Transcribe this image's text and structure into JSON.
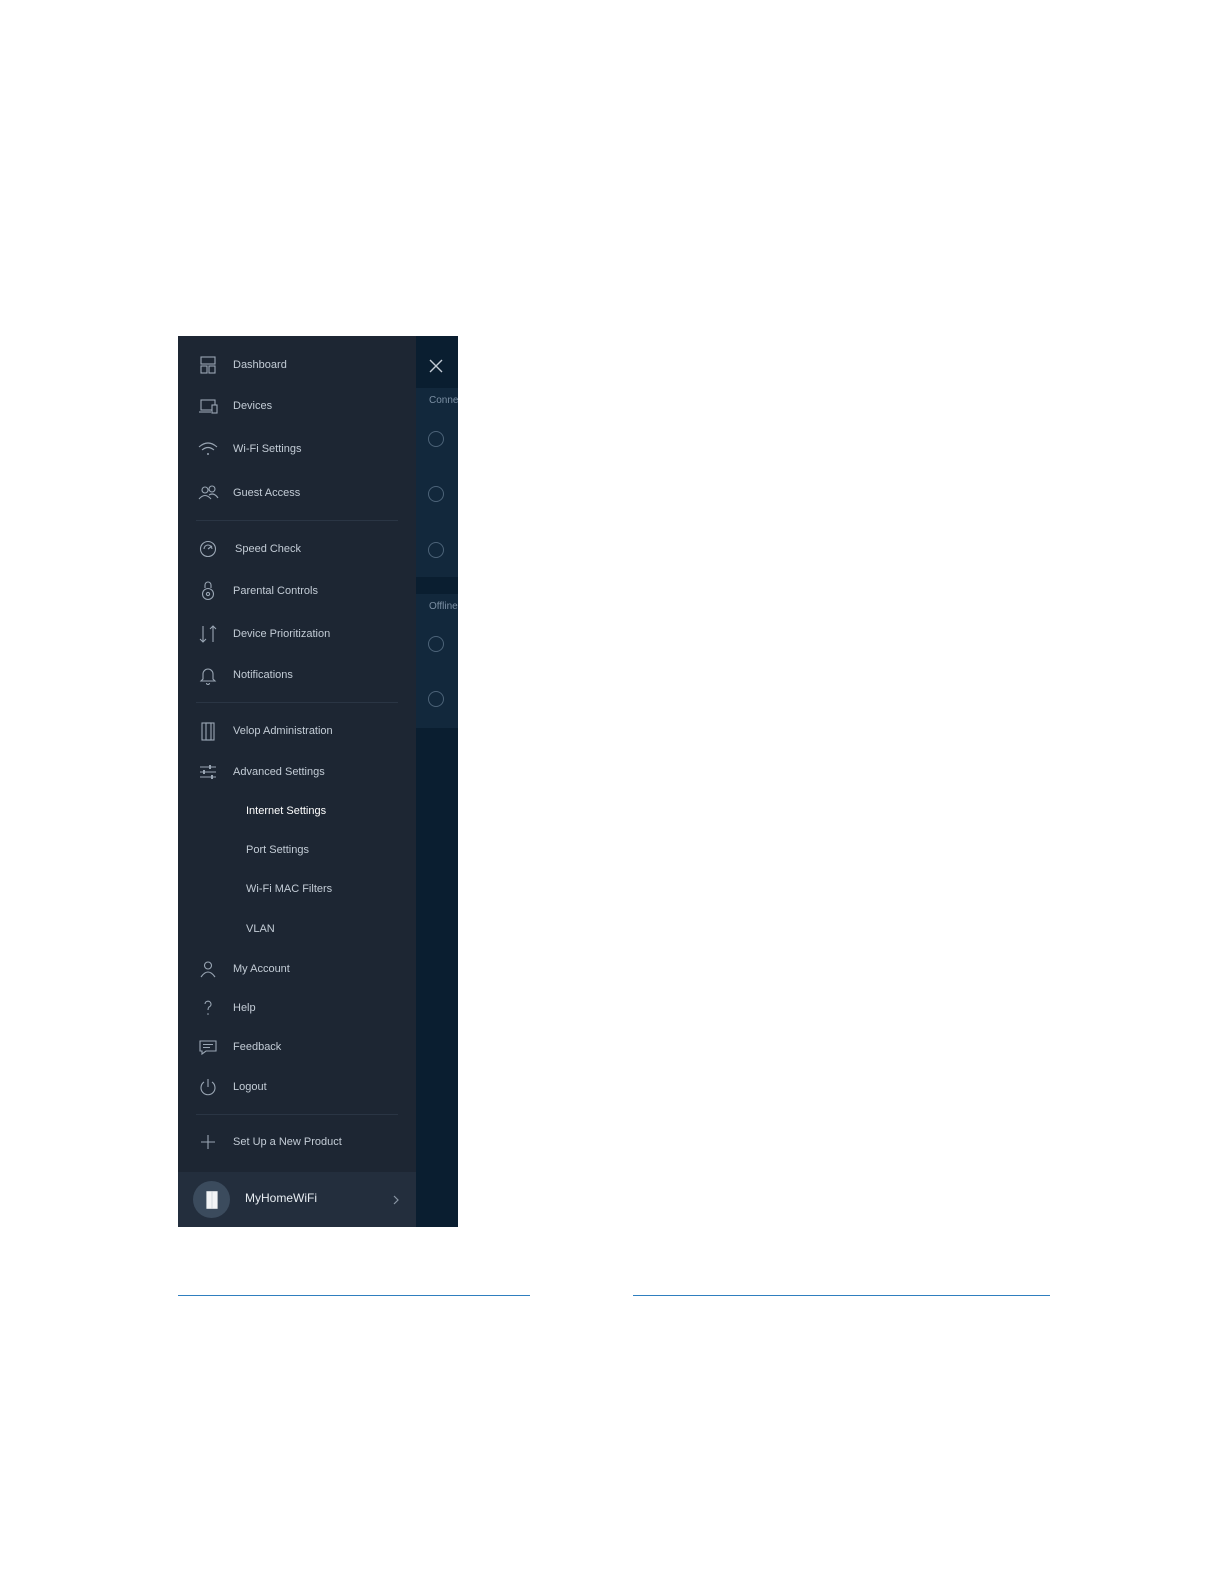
{
  "menu": {
    "items": [
      {
        "label": "Dashboard",
        "icon": "dashboard-icon"
      },
      {
        "label": "Devices",
        "icon": "devices-icon"
      },
      {
        "label": "Wi-Fi Settings",
        "icon": "wifi-icon"
      },
      {
        "label": "Guest Access",
        "icon": "guests-icon"
      },
      {
        "label": "Speed Check",
        "icon": "speedometer-icon"
      },
      {
        "label": "Parental Controls",
        "icon": "lock-icon"
      },
      {
        "label": "Device Prioritization",
        "icon": "priority-arrows-icon"
      },
      {
        "label": "Notifications",
        "icon": "bell-icon"
      },
      {
        "label": "Velop Administration",
        "icon": "velop-node-icon"
      },
      {
        "label": "Advanced Settings",
        "icon": "sliders-icon"
      }
    ],
    "advanced_sub": [
      {
        "label": "Internet Settings",
        "active": true
      },
      {
        "label": "Port Settings"
      },
      {
        "label": "Wi-Fi MAC Filters"
      },
      {
        "label": "VLAN"
      }
    ],
    "account_items": [
      {
        "label": "My Account",
        "icon": "user-icon"
      },
      {
        "label": "Help",
        "icon": "question-icon"
      },
      {
        "label": "Feedback",
        "icon": "chat-icon"
      },
      {
        "label": "Logout",
        "icon": "power-icon"
      }
    ],
    "setup": {
      "label": "Set Up a New Product",
      "icon": "plus-icon"
    },
    "network": {
      "name": "MyHomeWiFi"
    }
  },
  "behind": {
    "connected_label": "Conne",
    "offline_label": "Offline"
  },
  "colors": {
    "menu_bg": "#1d2633",
    "behind_bg": "#0a1e30",
    "rule": "#2f7fbf"
  }
}
